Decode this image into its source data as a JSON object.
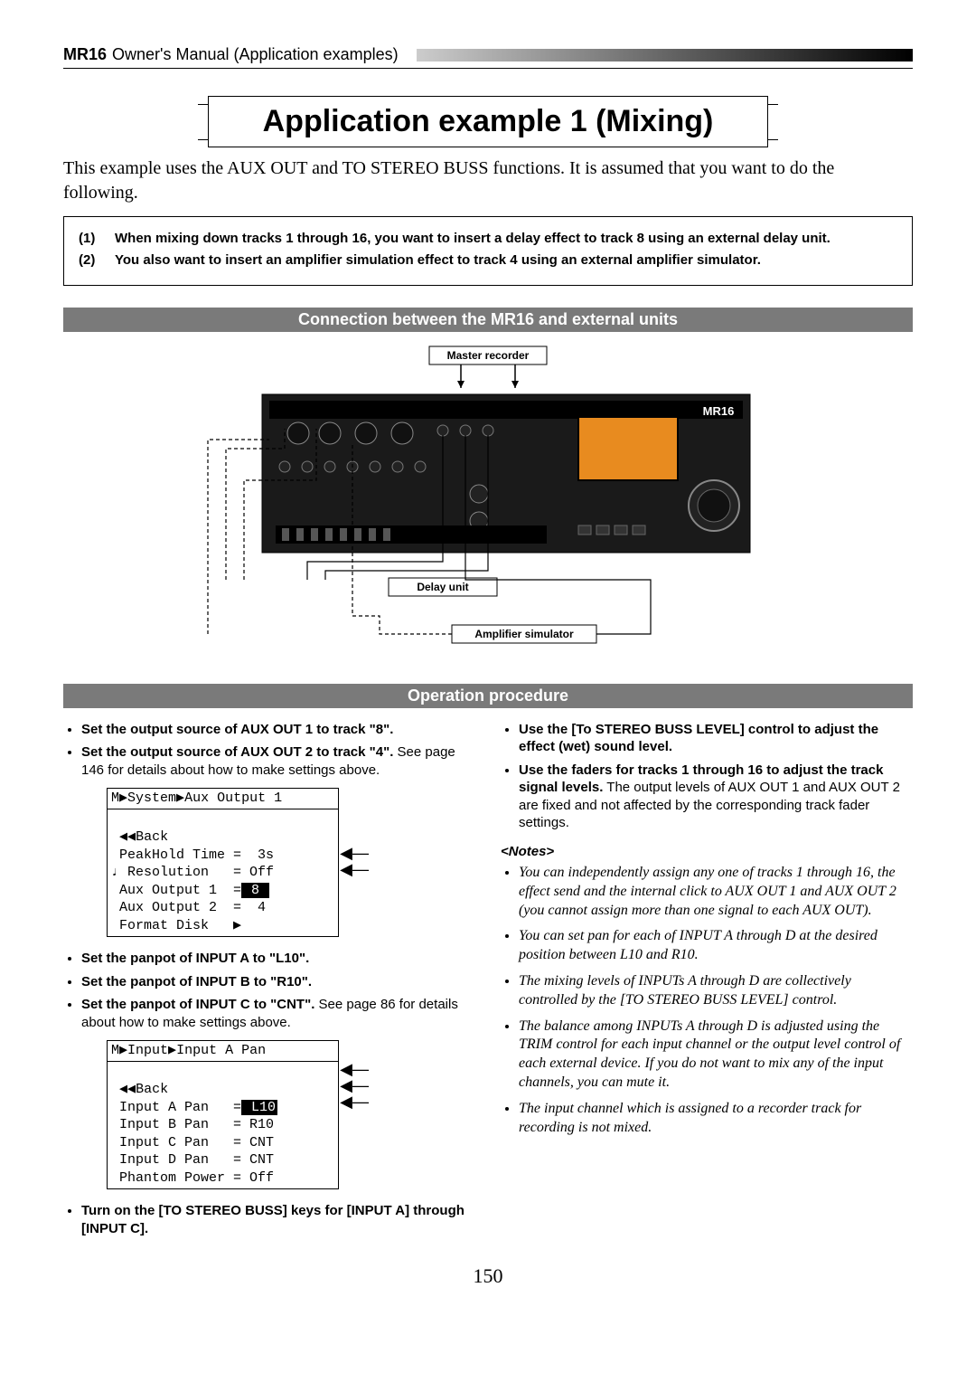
{
  "header": {
    "model": "MR16",
    "subtitle": "Owner's Manual (Application examples)"
  },
  "title": "Application example 1 (Mixing)",
  "intro": "This example uses the AUX OUT and TO STEREO BUSS functions. It is assumed that you want to do the following.",
  "callouts": [
    {
      "num": "(1)",
      "text": "When mixing down tracks 1 through 16, you want to insert a delay effect to track 8 using an external delay unit."
    },
    {
      "num": "(2)",
      "text": "You also want to insert an amplifier simulation effect to track 4 using an external amplifier simulator."
    }
  ],
  "section1": "Connection between the MR16 and external units",
  "diagram": {
    "master_recorder": "Master recorder",
    "delay_unit": "Delay unit",
    "amp_sim": "Amplifier simulator",
    "brand": "MR16"
  },
  "section2": "Operation procedure",
  "left": {
    "items": [
      {
        "strong": "Set the output source of AUX OUT 1 to track \"8\"."
      },
      {
        "strong": "Set the output source of AUX OUT 2 to track \"4\".",
        "body": "See page 146 for details about how to make settings above."
      }
    ],
    "screen1": {
      "title": "M▶System▶Aux Output 1",
      "back": " ◀◀Back",
      "l1": " PeakHold Time =  3s",
      "l2": "♩ Resolution   = Off",
      "l3a": " Aux Output 1  =",
      "l3hl": " 8 ",
      "l4": " Aux Output 2  =  4",
      "l5": " Format Disk   ▶"
    },
    "items2": [
      {
        "strong": "Set the panpot of INPUT A to \"L10\"."
      },
      {
        "strong": "Set the panpot of INPUT B to \"R10\"."
      },
      {
        "strong": "Set the panpot of INPUT C to \"CNT\".",
        "body": "See page 86 for details about how to make settings above."
      }
    ],
    "screen2": {
      "title": "M▶Input▶Input A Pan",
      "back": " ◀◀Back",
      "l1a": " Input A Pan   =",
      "l1hl": " L10",
      "l2": " Input B Pan   = R10",
      "l3": " Input C Pan   = CNT",
      "l4": " Input D Pan   = CNT",
      "l5": " Phantom Power = Off"
    },
    "items3": [
      {
        "strong": "Turn on the [TO STEREO BUSS] keys for [INPUT A] through [INPUT C]."
      }
    ]
  },
  "right": {
    "items": [
      {
        "strong": "Use the [To STEREO BUSS LEVEL] control to adjust the effect (wet) sound level."
      },
      {
        "strong": "Use the faders for tracks 1 through 16 to adjust the track signal levels.",
        "body": "The output levels of AUX OUT 1 and AUX OUT 2 are fixed and not affected by the corresponding track fader settings."
      }
    ],
    "notes_head": "<Notes>",
    "notes": [
      "You can independently assign any one of tracks 1 through 16, the effect send and the internal click to AUX OUT 1 and AUX OUT 2 (you cannot assign more than one signal to each AUX OUT).",
      "You can set pan for each of INPUT A through D at the desired position between L10 and R10.",
      "The mixing levels of INPUTs A through D are collectively controlled by the [TO STEREO BUSS LEVEL] control.",
      "The balance among INPUTs A through D is adjusted using the TRIM control for each input channel or the output level control of each external device. If you do not want to mix any of the input channels, you can mute it.",
      "The input channel which is assigned to a recorder track for recording is not mixed."
    ]
  },
  "page_num": "150"
}
